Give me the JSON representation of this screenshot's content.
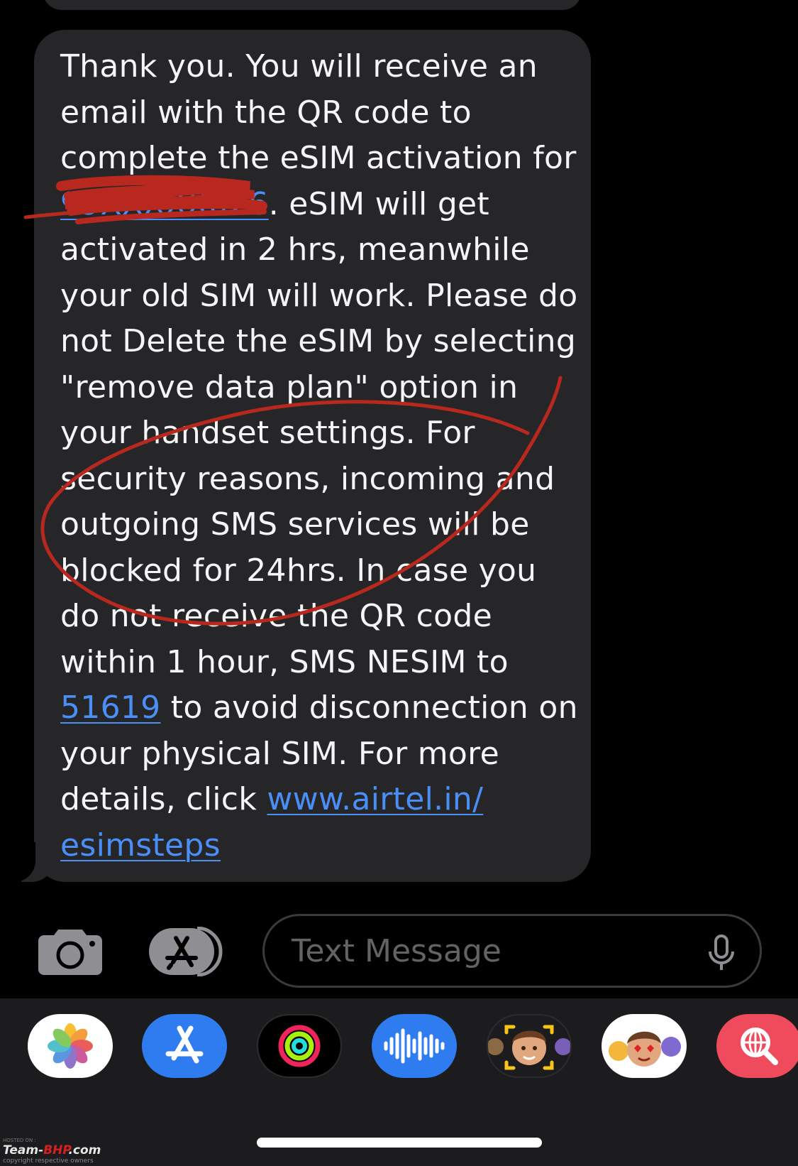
{
  "message": {
    "lines": [
      "Thank you. You will receive an",
      "email with the QR code to",
      "complete the eSIM activation for",
      {
        "phone_redacted": "99XXXXX026",
        "rest": ". eSIM will get"
      },
      "activated in 2 hrs, meanwhile",
      "your old SIM will work. Please do",
      "not Delete the eSIM by selecting",
      "\"remove data plan\" option in",
      "your handset settings. For",
      "security reasons, incoming and",
      "outgoing SMS services will be",
      "blocked for 24hrs. In case you",
      "do not receive the QR code",
      "within 1 hour, SMS NESIM to",
      {
        "link": "51619",
        "rest": " to avoid disconnection on"
      },
      "your physical SIM. For more",
      {
        "prefix": "details, click ",
        "link": "www.airtel.in/"
      },
      {
        "link": "esimsteps"
      }
    ]
  },
  "input_bar": {
    "placeholder": "Text Message",
    "camera_icon": "camera-icon",
    "apps_icon": "app-store-icon",
    "mic_icon": "microphone-icon"
  },
  "app_drawer": {
    "apps": [
      {
        "name": "photos-app-icon"
      },
      {
        "name": "app-store-app-icon"
      },
      {
        "name": "activity-app-icon"
      },
      {
        "name": "audio-message-app-icon"
      },
      {
        "name": "memoji-camera-app-icon"
      },
      {
        "name": "memoji-stickers-app-icon"
      },
      {
        "name": "images-search-app-icon"
      }
    ]
  },
  "watermark": {
    "top": "HOSTED ON :",
    "brand_a": "Team-",
    "brand_b": "BHP",
    "brand_c": ".com",
    "bottom": "copyright respective owners"
  },
  "colors": {
    "background": "#000000",
    "bubble": "#262628",
    "link": "#4A8FF7",
    "annotation": "#B8281E"
  }
}
